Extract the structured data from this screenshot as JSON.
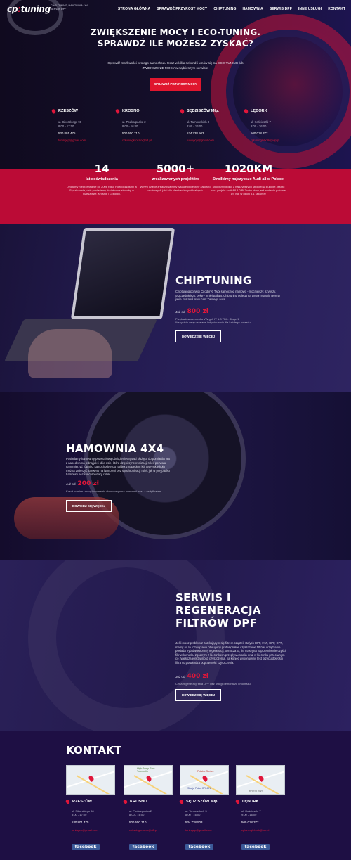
{
  "brand": {
    "logo_a": "cp",
    "logo_b": "tuning",
    "subtitle": "CHIP-TUNING, HAMOWNIA 4X4, SERWIS DPF"
  },
  "nav": [
    "STRONA GŁÓWNA",
    "SPRAWDŹ PRZYROST MOCY",
    "CHIPTUNING",
    "HAMOWNIA",
    "SERWIS DPF",
    "INNE USŁUGI",
    "KONTAKT"
  ],
  "hero": {
    "title_line1": "ZWIĘKSZENIE MOCY I ECO-TUNING.",
    "title_line2": "SPRAWDŹ ILE MOŻESZ ZYSKAĆ?",
    "text": "Sprawdź możliwości twojego samochodu teraz w kilka sekund i umów się na ECO-TUNING lub ZWIĘKSZENIE MOCY w najbliższym serwisie.",
    "button": "SPRAWDŹ PRZYROST MOCY"
  },
  "locations": [
    {
      "city": "RZESZÓW",
      "addr1": "ul. Sikorskiego 98",
      "addr2": "8:00 - 17:00",
      "phone": "530 801 475",
      "email": "tuningcp@gmail.com"
    },
    {
      "city": "KROSNO",
      "addr1": "ul. Podkarpacka 2",
      "addr2": "8:00 - 16:00",
      "phone": "500 550 710",
      "email": "cptuningkrosno@o2.pl"
    },
    {
      "city": "SĘDZISZÓW Młp.",
      "addr1": "ul. Tarnowskich 3",
      "addr2": "8:00 - 16:00",
      "phone": "534 738 503",
      "email": "tuningcp@gmail.com"
    },
    {
      "city": "LĘBORK",
      "addr1": "ul. Kościuszki 7",
      "addr2": "9:00 - 16:00",
      "phone": "500 018 372",
      "email": "cptuninglebork@wp.pl"
    }
  ],
  "stats": [
    {
      "num": "14",
      "label": "lat doświadczenia",
      "desc": "Działamy nieprzerwanie od 2006 roku. Rozpoczęliśmy w Sędziszowie, dziś posiadamy dodatkowe siedziby w Rzeszowie, Krośnie i Lęborku."
    },
    {
      "num": "5000+",
      "label": "zrealizowanych projektów",
      "desc": "W tym czasie zrealizowaliśmy tysiące projektów zarówno osobowych jak i dla klientów indywidualnych."
    },
    {
      "num": "1020KM",
      "label": "Stroiliśmy najszybsze Audi a8 w Polsce.",
      "desc": "Stroiliśmy jedno z najszybszych stroiciel w Europie, jest to nasz projekt Audi A8 4.0 Bi-Turbo który jest w stanie pokonać 1/4 mili w około 8.1 sekundy."
    }
  ],
  "chiptuning": {
    "title": "CHIPTUNING",
    "text": "Chiptuning pozwoli Ci odkryć Twój samochód na nowo - mocniejszy, szybszy, oszczędniejszy, pełgry mniej paliwa. Chiptuning polega na wykorzystaniu rezerw jakie zostawił producent Twojego auta.",
    "price_prefix": "Już od",
    "price": "800 zł",
    "note1": "Przykładowa cena dla VW golf IV 1.8 TDI - Stage 1",
    "note2": "Wszystkie ceny ustalane indywidualnie dla każdego pojazdu",
    "button": "DOWIEDZ SIĘ WIĘCEJ"
  },
  "hamownia": {
    "title": "HAMOWNIA 4X4",
    "text": "Posiadamy hamownię podwoziową obciążeniową 4wd służącą do pomiarów aut z napędem na jedną jak i obie osie, która dzięki synchronizacji rolek pozwala nam mierzyć również samochody typu haldex z napędem kół wszystkie koła można zmierzyć zarówno na hamowni bez synchronizacji rolek jak w przypadku hamowni bez synchronizacji rolek.",
    "price_prefix": "Już od",
    "price": "200 zł",
    "note1": "Koszt pomiaru mocy i momentu obrotowego na hamowni wraz z certyfikatem.",
    "button": "DOWIEDZ SIĘ WIĘCEJ"
  },
  "dpf": {
    "title_line1": "SERWIS I",
    "title_line2": "REGENERACJA",
    "title_line3": "FILTRÓW DPF",
    "text": "Jeśli masz problem z zatykającym się filtrem cząstek stałych DPF, FAP, GPF, OPF, mamy na to rozwiązanie oferujemy profesjonalne czyszczenie filtrów, urządzenie posiada tryb dwustronnej regeneracji, oznacza to, że maszyna naprzemiennie czyści filtr w kierunku zgodnym z kierunkiem przepływu spalin oraz w kierunku przeciwnym co zwiększa efektywność czyszczenia, na koniec wykonujemy test przepustowości filtra co potwierdza poprawność czyszczenia.",
    "price_prefix": "Już od",
    "price": "400 zł",
    "note1": "Cena regeneracji filtra DPF bez usługi demontażu i montażu.",
    "button": "DOWIEDZ SIĘ WIĘCEJ"
  },
  "contact": {
    "title": "KONTAKT",
    "map_labels": [
      "High Jump Park Trampolin",
      "Polskie Słońce",
      "Stacja Paliw ORLEN",
      "KRYSTYNY"
    ],
    "facebook": "facebook"
  }
}
